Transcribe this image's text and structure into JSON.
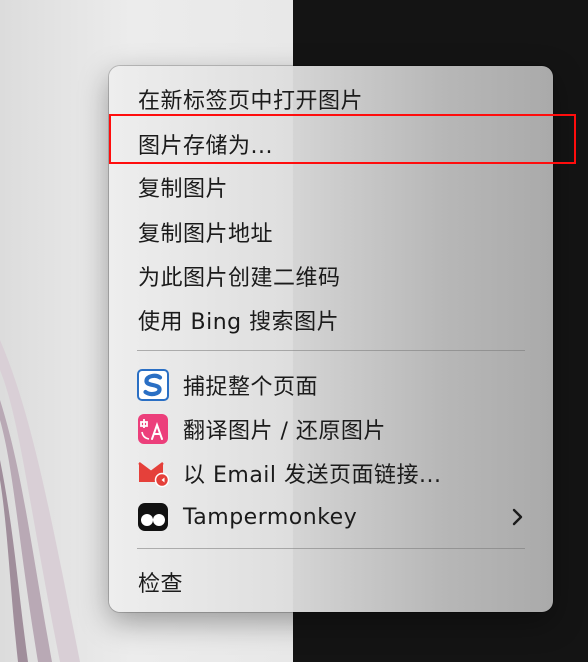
{
  "context_menu": {
    "items": [
      {
        "label": "在新标签页中打开图片"
      },
      {
        "label": "图片存储为..."
      },
      {
        "label": "复制图片"
      },
      {
        "label": "复制图片地址"
      },
      {
        "label": "为此图片创建二维码"
      },
      {
        "label": "使用 Bing 搜索图片"
      }
    ],
    "extension_items": [
      {
        "label": "捕捉整个页面",
        "icon": "screenshot-s-icon"
      },
      {
        "label": "翻译图片 / 还原图片",
        "icon": "translate-icon"
      },
      {
        "label": "以 Email 发送页面链接...",
        "icon": "email-icon"
      },
      {
        "label": "Tampermonkey",
        "icon": "tampermonkey-icon",
        "has_submenu": true
      }
    ],
    "inspect_label": "检查"
  },
  "highlight": {
    "target": "图片存储为...",
    "color": "#ff0d0d"
  },
  "colors": {
    "s_icon_blue": "#2a6fc4",
    "translate_pink": "#ec3f7b",
    "email_red": "#e5403a",
    "tamper_black": "#111111"
  }
}
